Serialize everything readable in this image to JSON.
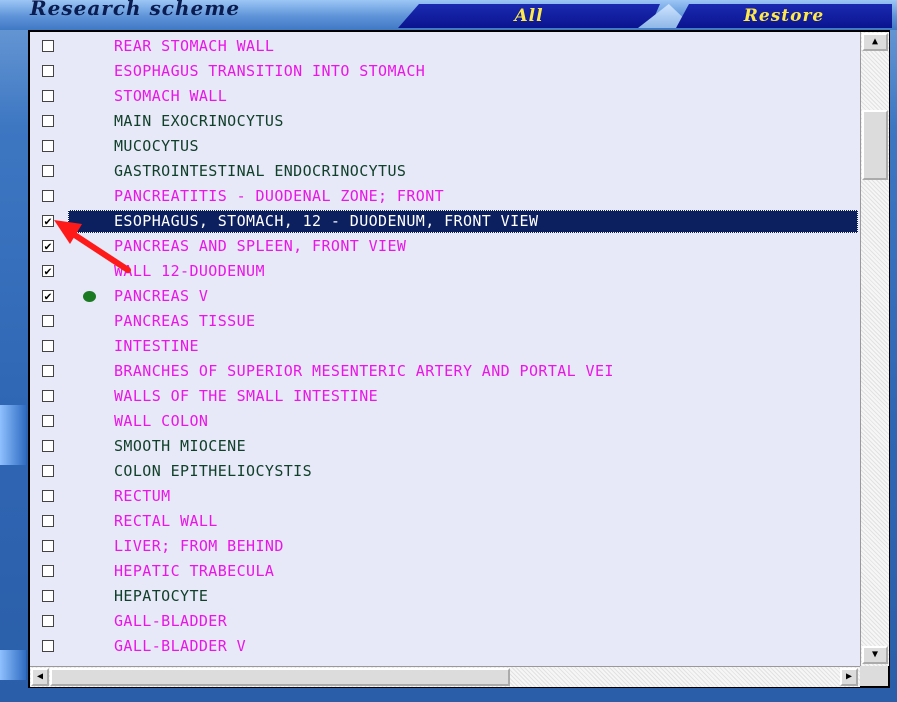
{
  "header": {
    "title": "Research scheme",
    "all_button": "All",
    "restore_button": "Restore"
  },
  "list": {
    "items": [
      {
        "label": "REAR STOMACH WALL",
        "checked": false,
        "color": "#ea16e8",
        "marker": false,
        "selected": false
      },
      {
        "label": "ESOPHAGUS TRANSITION INTO STOMACH",
        "checked": false,
        "color": "#ea16e8",
        "marker": false,
        "selected": false
      },
      {
        "label": "STOMACH WALL",
        "checked": false,
        "color": "#ea16e8",
        "marker": false,
        "selected": false
      },
      {
        "label": "MAIN EXOCRINOCYTUS",
        "checked": false,
        "color": "#11402a",
        "marker": false,
        "selected": false
      },
      {
        "label": "MUCOCYTUS",
        "checked": false,
        "color": "#11402a",
        "marker": false,
        "selected": false
      },
      {
        "label": "GASTROINTESTINAL ENDOCRINOCYTUS",
        "checked": false,
        "color": "#11402a",
        "marker": false,
        "selected": false
      },
      {
        "label": "PANCREATITIS - DUODENAL ZONE; FRONT",
        "checked": false,
        "color": "#ea16e8",
        "marker": false,
        "selected": false
      },
      {
        "label": "ESOPHAGUS, STOMACH, 12 - DUODENUM, FRONT VIEW",
        "checked": true,
        "color": "#ffffff",
        "marker": false,
        "selected": true
      },
      {
        "label": "PANCREAS  AND SPLEEN, FRONT VIEW",
        "checked": true,
        "color": "#ea16e8",
        "marker": false,
        "selected": false
      },
      {
        "label": "WALL 12-DUODENUM",
        "checked": true,
        "color": "#ea16e8",
        "marker": false,
        "selected": false
      },
      {
        "label": "PANCREAS  V",
        "checked": true,
        "color": "#ea16e8",
        "marker": true,
        "selected": false
      },
      {
        "label": "PANCREAS TISSUE",
        "checked": false,
        "color": "#ea16e8",
        "marker": false,
        "selected": false
      },
      {
        "label": "INTESTINE",
        "checked": false,
        "color": "#ea16e8",
        "marker": false,
        "selected": false
      },
      {
        "label": "BRANCHES OF SUPERIOR MESENTERIC ARTERY AND PORTAL VEI",
        "checked": false,
        "color": "#ea16e8",
        "marker": false,
        "selected": false
      },
      {
        "label": "WALLS OF THE SMALL INTESTINE",
        "checked": false,
        "color": "#ea16e8",
        "marker": false,
        "selected": false
      },
      {
        "label": "WALL COLON",
        "checked": false,
        "color": "#ea16e8",
        "marker": false,
        "selected": false
      },
      {
        "label": "SMOOTH MIOCENE",
        "checked": false,
        "color": "#11402a",
        "marker": false,
        "selected": false
      },
      {
        "label": "COLON EPITHELIOCYSTIS",
        "checked": false,
        "color": "#11402a",
        "marker": false,
        "selected": false
      },
      {
        "label": "RECTUM",
        "checked": false,
        "color": "#ea16e8",
        "marker": false,
        "selected": false
      },
      {
        "label": "RECTAL WALL",
        "checked": false,
        "color": "#ea16e8",
        "marker": false,
        "selected": false
      },
      {
        "label": "LIVER; FROM BEHIND",
        "checked": false,
        "color": "#ea16e8",
        "marker": false,
        "selected": false
      },
      {
        "label": "HEPATIC TRABECULA",
        "checked": false,
        "color": "#ea16e8",
        "marker": false,
        "selected": false
      },
      {
        "label": "HEPATOCYTE",
        "checked": false,
        "color": "#11402a",
        "marker": false,
        "selected": false
      },
      {
        "label": "GALL-BLADDER",
        "checked": false,
        "color": "#ea16e8",
        "marker": false,
        "selected": false
      },
      {
        "label": "GALL-BLADDER V",
        "checked": false,
        "color": "#ea16e8",
        "marker": false,
        "selected": false
      }
    ]
  },
  "colors": {
    "list_background": "#e7e8f8",
    "selection": "#0c2060",
    "annotation_arrow": "#ff1a1a",
    "marker_dot": "#1a7a22"
  },
  "icons": {
    "scroll_up": "up-arrow-icon",
    "scroll_down": "down-arrow-icon",
    "scroll_left": "left-arrow-icon",
    "scroll_right": "right-arrow-icon",
    "marker": "green-dot-icon"
  }
}
